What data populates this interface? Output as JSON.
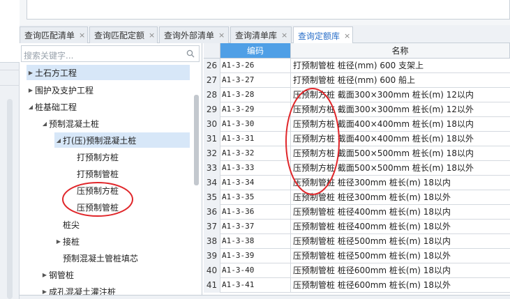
{
  "tabs": [
    {
      "label": "查询匹配清单",
      "close": "×"
    },
    {
      "label": "查询匹配定额",
      "close": "×"
    },
    {
      "label": "查询外部清单",
      "close": "×"
    },
    {
      "label": "查询清单库",
      "close": "×"
    },
    {
      "label": "查询定额库",
      "close": "×",
      "active": true
    }
  ],
  "search": {
    "placeholder": "搜索关键字..."
  },
  "tree": [
    {
      "label": "土石方工程",
      "expander": "▶",
      "selected": true
    },
    {
      "label": "围护及支护工程",
      "expander": "▶"
    },
    {
      "label": "桩基础工程",
      "expander": "◢"
    },
    {
      "label": "预制混凝土桩",
      "expander": "◢"
    },
    {
      "label": "打(压)预制混凝土桩",
      "expander": "◢",
      "selected": true
    },
    {
      "label": "打预制方桩",
      "expander": ""
    },
    {
      "label": "打预制管桩",
      "expander": ""
    },
    {
      "label": "压预制方桩",
      "expander": ""
    },
    {
      "label": "压预制管桩",
      "expander": ""
    },
    {
      "label": "桩尖",
      "expander": ""
    },
    {
      "label": "接桩",
      "expander": "▶"
    },
    {
      "label": "预制混凝土管桩填芯",
      "expander": ""
    },
    {
      "label": "钢管桩",
      "expander": "▶"
    },
    {
      "label": "成孔混凝土灌注桩",
      "expander": "▶"
    }
  ],
  "table": {
    "headers": {
      "code": "编码",
      "name": "名称"
    },
    "rows": [
      {
        "n": "26",
        "code": "A1-3-26",
        "name": "打预制管桩 桩径(mm) 600 支架上"
      },
      {
        "n": "27",
        "code": "A1-3-27",
        "name": "打预制管桩 桩径(mm) 600 船上"
      },
      {
        "n": "28",
        "code": "A1-3-28",
        "name": "压预制方桩 截面300×300mm 桩长(m) 12以内"
      },
      {
        "n": "29",
        "code": "A1-3-29",
        "name": "压预制方桩 截面300×300mm 桩长(m) 12以外"
      },
      {
        "n": "30",
        "code": "A1-3-30",
        "name": "压预制方桩 截面400×400mm 桩长(m) 18以内"
      },
      {
        "n": "31",
        "code": "A1-3-31",
        "name": "压预制方桩 截面400×400mm 桩长(m) 18以外"
      },
      {
        "n": "32",
        "code": "A1-3-32",
        "name": "压预制方桩 截面500×500mm 桩长(m) 18以内"
      },
      {
        "n": "33",
        "code": "A1-3-33",
        "name": "压预制方桩 截面500×500mm 桩长(m) 18以外"
      },
      {
        "n": "34",
        "code": "A1-3-34",
        "name": "压预制管桩 桩径300mm 桩长(m) 18以内"
      },
      {
        "n": "35",
        "code": "A1-3-35",
        "name": "压预制管桩 桩径300mm 桩长(m) 18以外"
      },
      {
        "n": "36",
        "code": "A1-3-36",
        "name": "压预制管桩 桩径400mm 桩长(m) 18以内"
      },
      {
        "n": "37",
        "code": "A1-3-37",
        "name": "压预制管桩 桩径400mm 桩长(m) 18以外"
      },
      {
        "n": "38",
        "code": "A1-3-38",
        "name": "压预制管桩 桩径500mm 桩长(m) 18以内"
      },
      {
        "n": "39",
        "code": "A1-3-39",
        "name": "压预制管桩 桩径500mm 桩长(m) 18以外"
      },
      {
        "n": "40",
        "code": "A1-3-40",
        "name": "压预制管桩 桩径600mm 桩长(m) 18以内"
      },
      {
        "n": "41",
        "code": "A1-3-41",
        "name": "压预制管桩 桩径600mm 桩长(m) 18以外"
      }
    ]
  },
  "colors": {
    "accent": "#4f9fe6",
    "selection": "#d7e7f8",
    "annotation": "#e0262a"
  }
}
